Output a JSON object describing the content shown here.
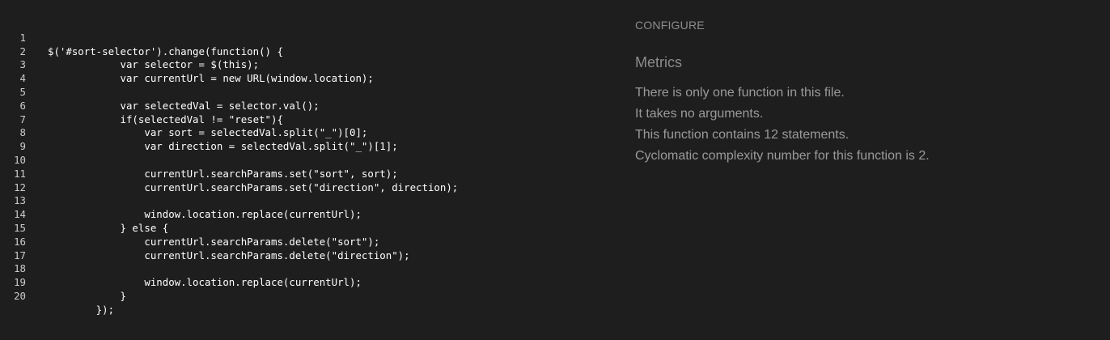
{
  "code": {
    "lines": [
      {
        "number": "1",
        "text": "$('#sort-selector').change(function() {"
      },
      {
        "number": "2",
        "text": "            var selector = $(this);"
      },
      {
        "number": "3",
        "text": "            var currentUrl = new URL(window.location);"
      },
      {
        "number": "4",
        "text": ""
      },
      {
        "number": "5",
        "text": "            var selectedVal = selector.val();"
      },
      {
        "number": "6",
        "text": "            if(selectedVal != \"reset\"){"
      },
      {
        "number": "7",
        "text": "                var sort = selectedVal.split(\"_\")[0];"
      },
      {
        "number": "8",
        "text": "                var direction = selectedVal.split(\"_\")[1];"
      },
      {
        "number": "9",
        "text": ""
      },
      {
        "number": "10",
        "text": "                currentUrl.searchParams.set(\"sort\", sort);"
      },
      {
        "number": "11",
        "text": "                currentUrl.searchParams.set(\"direction\", direction);"
      },
      {
        "number": "12",
        "text": ""
      },
      {
        "number": "13",
        "text": "                window.location.replace(currentUrl);"
      },
      {
        "number": "14",
        "text": "            } else {"
      },
      {
        "number": "15",
        "text": "                currentUrl.searchParams.delete(\"sort\");"
      },
      {
        "number": "16",
        "text": "                currentUrl.searchParams.delete(\"direction\");"
      },
      {
        "number": "17",
        "text": ""
      },
      {
        "number": "18",
        "text": "                window.location.replace(currentUrl);"
      },
      {
        "number": "19",
        "text": "            }"
      },
      {
        "number": "20",
        "text": "        });"
      }
    ]
  },
  "sidebar": {
    "configure_label": "CONFIGURE",
    "metrics_title": "Metrics",
    "metrics": [
      "There is only one function in this file.",
      "It takes no arguments.",
      "This function contains 12 statements.",
      "Cyclomatic complexity number for this function is 2."
    ]
  },
  "colors": {
    "background": "#1e1e1e",
    "code_text": "#ffffff",
    "muted_text": "#8c8c8c"
  }
}
